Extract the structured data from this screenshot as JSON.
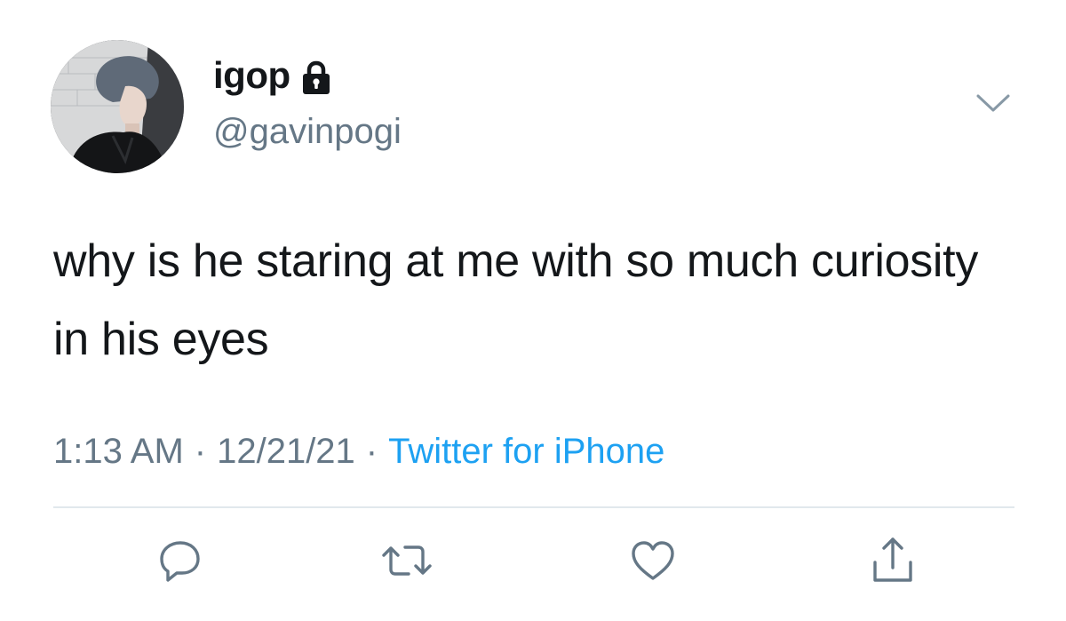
{
  "user": {
    "display_name": "igop",
    "handle": "@gavinpogi",
    "protected_icon": "lock-icon",
    "avatar": "profile-photo"
  },
  "tweet": {
    "text": "why is he staring at me with so much curiosity in his eyes",
    "time": "1:13 AM",
    "separator": "·",
    "date": "12/21/21",
    "source": "Twitter for iPhone"
  },
  "menu": {
    "icon": "chevron-down-icon"
  },
  "actions": [
    {
      "name": "reply",
      "icon": "reply-icon"
    },
    {
      "name": "retweet",
      "icon": "retweet-icon"
    },
    {
      "name": "like",
      "icon": "heart-icon"
    },
    {
      "name": "share",
      "icon": "share-icon"
    }
  ],
  "colors": {
    "text": "#14171a",
    "secondary": "#657786",
    "link": "#1da1f2",
    "divider": "#e1e8ed"
  }
}
